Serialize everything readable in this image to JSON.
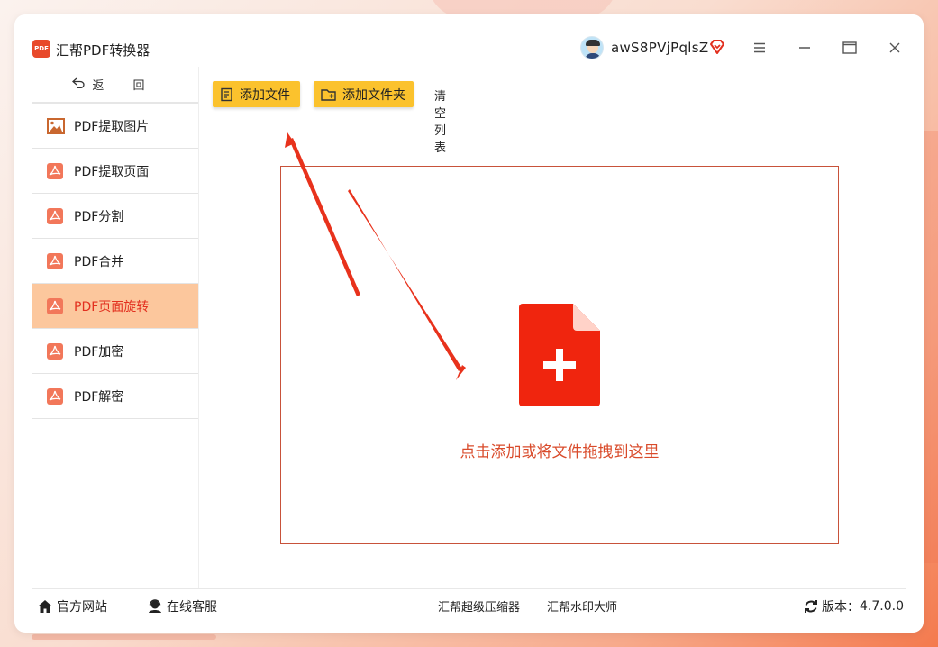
{
  "app": {
    "title": "汇帮PDF转换器",
    "logo_text": "PDF"
  },
  "user": {
    "name": "awS8PVjPqlsZ"
  },
  "sidebar": {
    "back_label": "返 回",
    "items": [
      {
        "label": "PDF提取图片",
        "icon": "image-icon",
        "active": false
      },
      {
        "label": "PDF提取页面",
        "icon": "pdf-icon",
        "active": false
      },
      {
        "label": "PDF分割",
        "icon": "pdf-icon",
        "active": false
      },
      {
        "label": "PDF合并",
        "icon": "pdf-icon",
        "active": false
      },
      {
        "label": "PDF页面旋转",
        "icon": "pdf-icon",
        "active": true
      },
      {
        "label": "PDF加密",
        "icon": "pdf-icon",
        "active": false
      },
      {
        "label": "PDF解密",
        "icon": "pdf-icon",
        "active": false
      }
    ]
  },
  "toolbar": {
    "add_file": "添加文件",
    "add_folder": "添加文件夹",
    "clear_list": "清空列表"
  },
  "dropzone": {
    "hint": "点击添加或将文件拖拽到这里"
  },
  "footer": {
    "website": "官方网站",
    "service": "在线客服",
    "compressor": "汇帮超级压缩器",
    "watermark": "汇帮水印大师",
    "version_label": "版本：",
    "version": "4.7.0.0"
  },
  "colors": {
    "accent": "#fbc22d",
    "active_bg": "#fcc79d",
    "active_text": "#e2301f",
    "file_icon": "#f0250e",
    "hint_text": "#d94b2b"
  }
}
